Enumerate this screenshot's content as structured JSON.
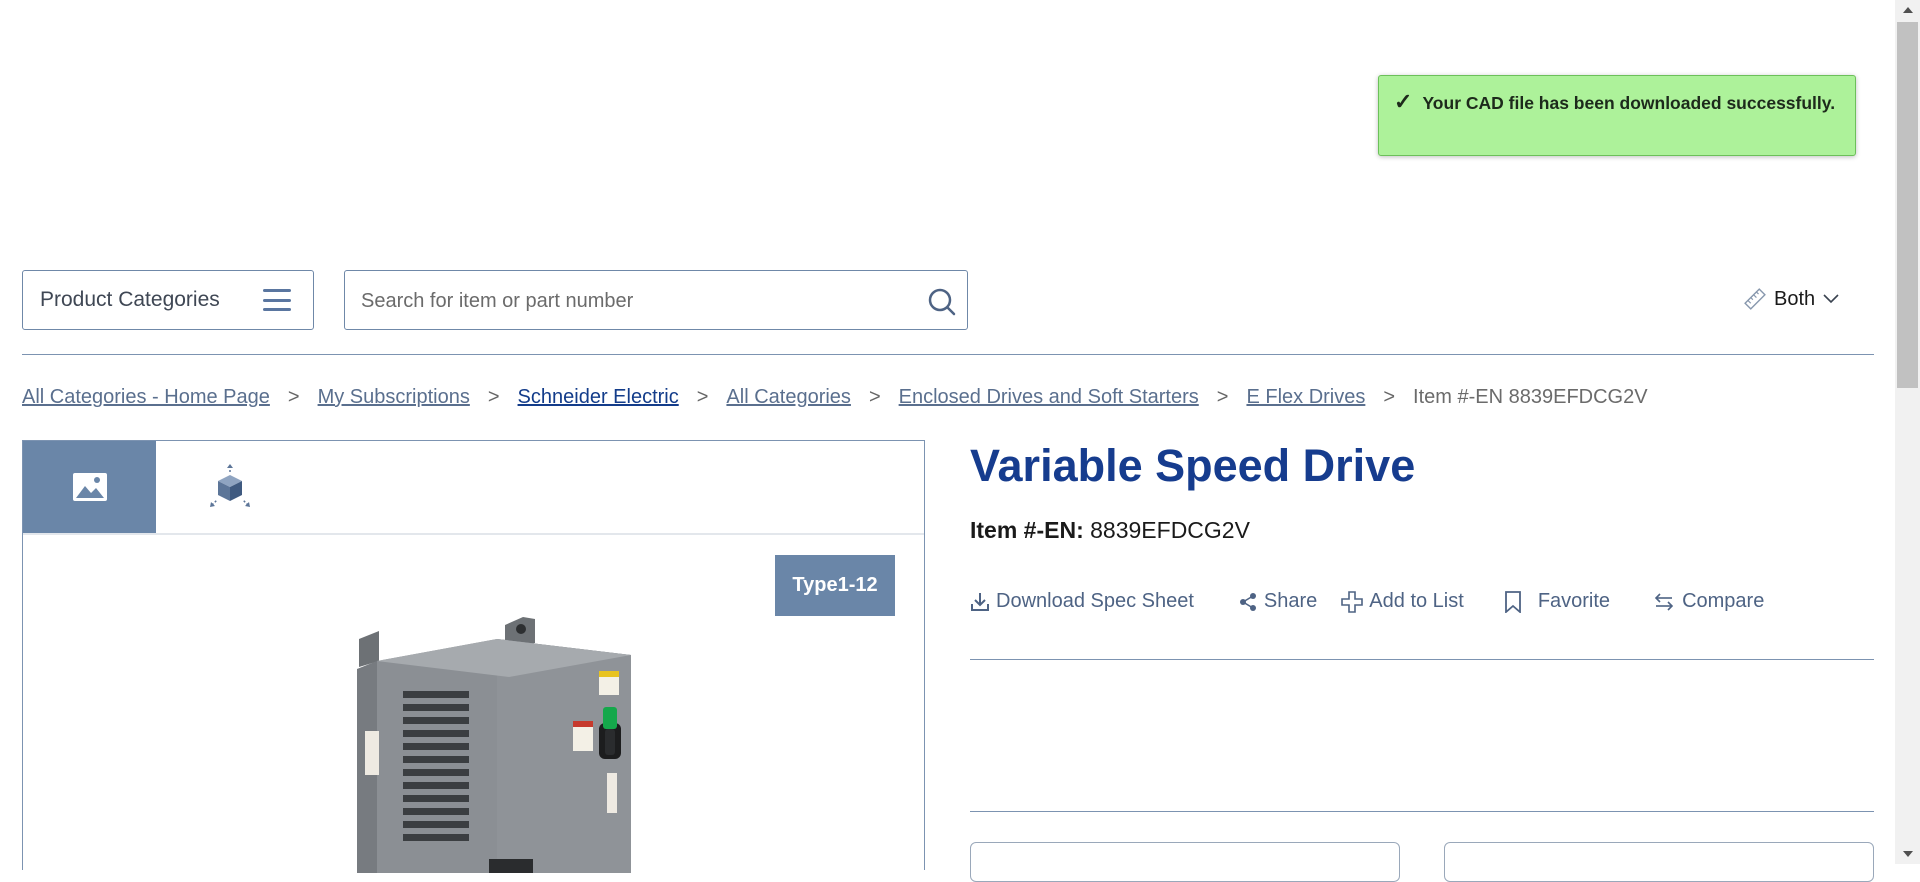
{
  "toast": {
    "icon": "checkmark-icon",
    "message": "Your CAD file has been downloaded successfully."
  },
  "categories_button": {
    "label": "Product Categories",
    "icon": "hamburger-menu-icon"
  },
  "search": {
    "placeholder": "Search for item or part number",
    "value": "",
    "icon": "search-icon"
  },
  "units": {
    "icon": "ruler-icon",
    "label": "Both",
    "caret": "chevron-down-icon"
  },
  "breadcrumb": [
    {
      "label": "All Categories - Home Page"
    },
    {
      "label": "My Subscriptions"
    },
    {
      "label": "Schneider Electric"
    },
    {
      "label": "All Categories"
    },
    {
      "label": "Enclosed Drives and Soft Starters"
    },
    {
      "label": "E Flex Drives"
    },
    {
      "label": "Item #-EN 8839EFDCG2V"
    }
  ],
  "breadcrumb_separator": ">",
  "media": {
    "tabs": [
      {
        "icon": "image-icon",
        "active": true
      },
      {
        "icon": "3d-cube-icon",
        "active": false
      }
    ],
    "badge": "Type1-12"
  },
  "product": {
    "title": "Variable Speed Drive",
    "item_label": "Item #-EN:",
    "item_number": "8839EFDCG2V"
  },
  "actions": [
    {
      "label": "Download Spec Sheet",
      "icon": "download-icon"
    },
    {
      "label": "Share",
      "icon": "share-icon"
    },
    {
      "label": "Add to List",
      "icon": "add-to-list-icon"
    },
    {
      "label": "Favorite",
      "icon": "bookmark-icon"
    },
    {
      "label": "Compare",
      "icon": "compare-icon"
    }
  ],
  "colors": {
    "accent": "#163c8e",
    "tab_active": "#6a86a8",
    "toast_bg": "#adf29a"
  }
}
